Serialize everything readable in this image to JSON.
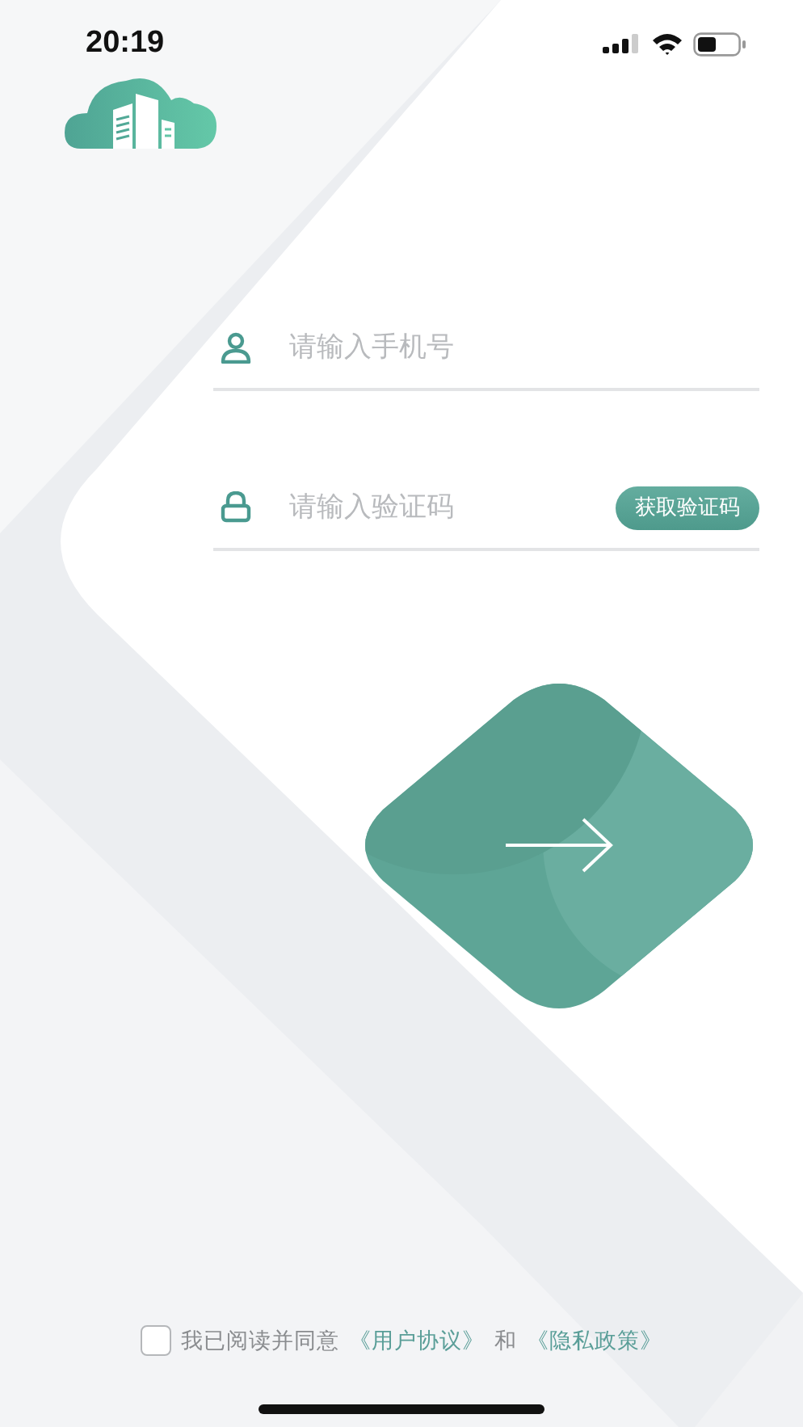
{
  "status_bar": {
    "time": "20:19"
  },
  "phone_field": {
    "placeholder": "请输入手机号"
  },
  "code_field": {
    "placeholder": "请输入验证码"
  },
  "get_code_button": {
    "label": "获取验证码"
  },
  "agreement": {
    "checked": false,
    "parts": [
      {
        "kind": "text",
        "text": "我已阅读并同意"
      },
      {
        "kind": "link",
        "text": "《用户协议》"
      },
      {
        "kind": "text",
        "text": "和"
      },
      {
        "kind": "link",
        "text": "《隐私政策》"
      }
    ]
  }
}
